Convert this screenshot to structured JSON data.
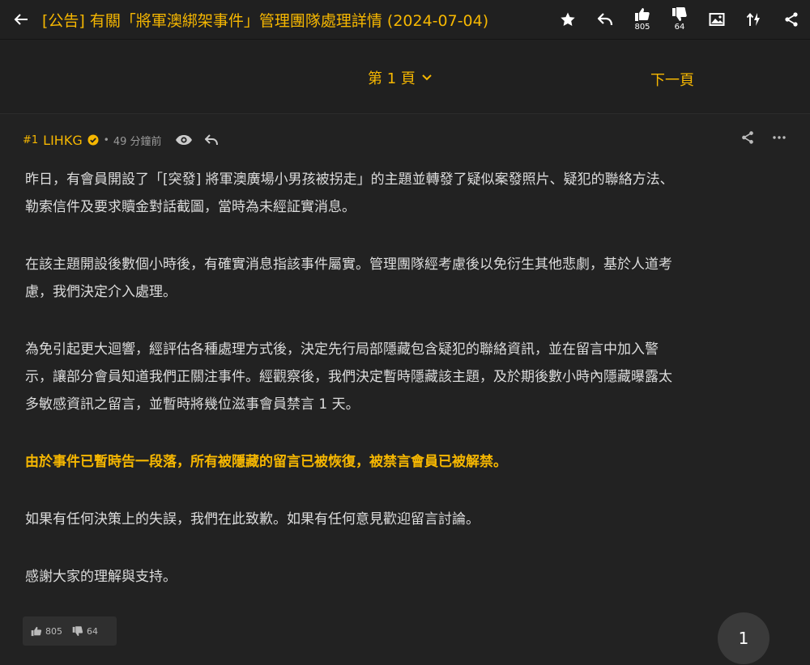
{
  "header": {
    "title": "[公告] 有關「將軍澳綁架事件」管理團隊處理詳情 (2024-07-04)",
    "like_count": "805",
    "dislike_count": "64"
  },
  "pager": {
    "current_page": "第 1 頁",
    "next_page": "下一頁"
  },
  "post": {
    "floor": "#1",
    "username": "LIHKG",
    "separator": "•",
    "time": "49 分鐘前",
    "paragraphs": [
      {
        "lines": [
          "昨日，有會員開設了「[突發] 將軍澳廣場小男孩被拐走」的主題並轉發了疑似案發照片、疑犯的聯絡方法、",
          "勒索信件及要求贖金對話截圖，當時為未經証實消息。"
        ]
      },
      {
        "lines": [
          "在該主題開設後數個小時後，有確實消息指該事件屬實。管理團隊經考慮後以免衍生其他悲劇，基於人道考",
          "慮，我們決定介入處理。"
        ]
      },
      {
        "lines": [
          "為免引起更大迴響，經評估各種處理方式後，決定先行局部隱藏包含疑犯的聯絡資訊，並在留言中加入警",
          "示，讓部分會員知道我們正關注事件。經觀察後，我們決定暫時隱藏該主題，及於期後數小時內隱藏曝露太",
          "多敏感資訊之留言，並暫時將幾位滋事會員禁言 1 天。"
        ]
      },
      {
        "lines": [
          "由於事件已暫時告一段落，所有被隱藏的留言已被恢復，被禁言會員已被解禁。"
        ]
      },
      {
        "lines": [
          "如果有任何決策上的失誤，我們在此致歉。如果有任何意見歡迎留言討論。"
        ]
      },
      {
        "lines": [
          "感謝大家的理解與支持。"
        ]
      }
    ],
    "like_count": "805",
    "dislike_count": "64"
  },
  "fab": {
    "label": "1"
  },
  "colors": {
    "accent": "#f6b701",
    "background": "#1b1b1b",
    "panel": "#222222"
  }
}
